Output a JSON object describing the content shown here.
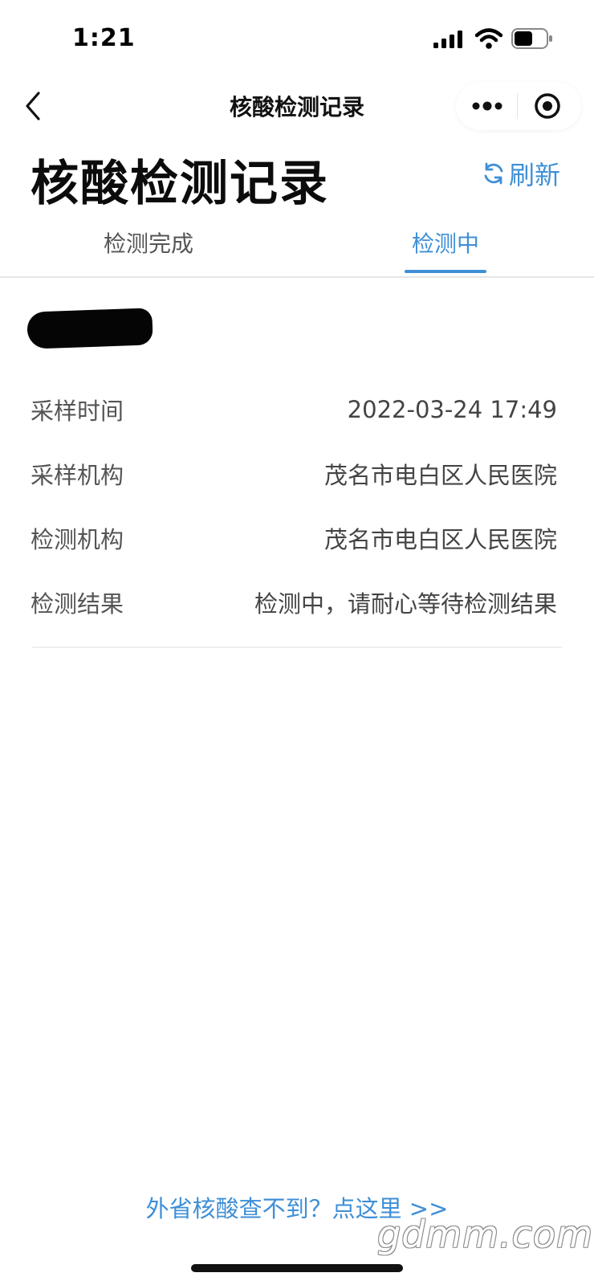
{
  "status_bar": {
    "time": "1:21"
  },
  "nav": {
    "title": "核酸检测记录"
  },
  "header": {
    "title": "核酸检测记录",
    "refresh_label": "刷新"
  },
  "tabs": [
    {
      "label": "检测完成",
      "active": false
    },
    {
      "label": "检测中",
      "active": true
    }
  ],
  "record": {
    "rows": [
      {
        "label": "采样时间",
        "value": "2022-03-24 17:49"
      },
      {
        "label": "采样机构",
        "value": "茂名市电白区人民医院"
      },
      {
        "label": "检测机构",
        "value": "茂名市电白区人民医院"
      },
      {
        "label": "检测结果",
        "value": "检测中，请耐心等待检测结果"
      }
    ]
  },
  "footer": {
    "link": "外省核酸查不到？点这里 >>"
  },
  "watermark": "gdmm.com",
  "colors": {
    "accent": "#3f8fd6",
    "text": "#111111",
    "muted": "#555555",
    "divider": "#e6e6e6"
  },
  "icons": {
    "back": "chevron-left-icon",
    "more": "more-dots-icon",
    "close": "target-close-icon",
    "refresh": "refresh-icon"
  }
}
